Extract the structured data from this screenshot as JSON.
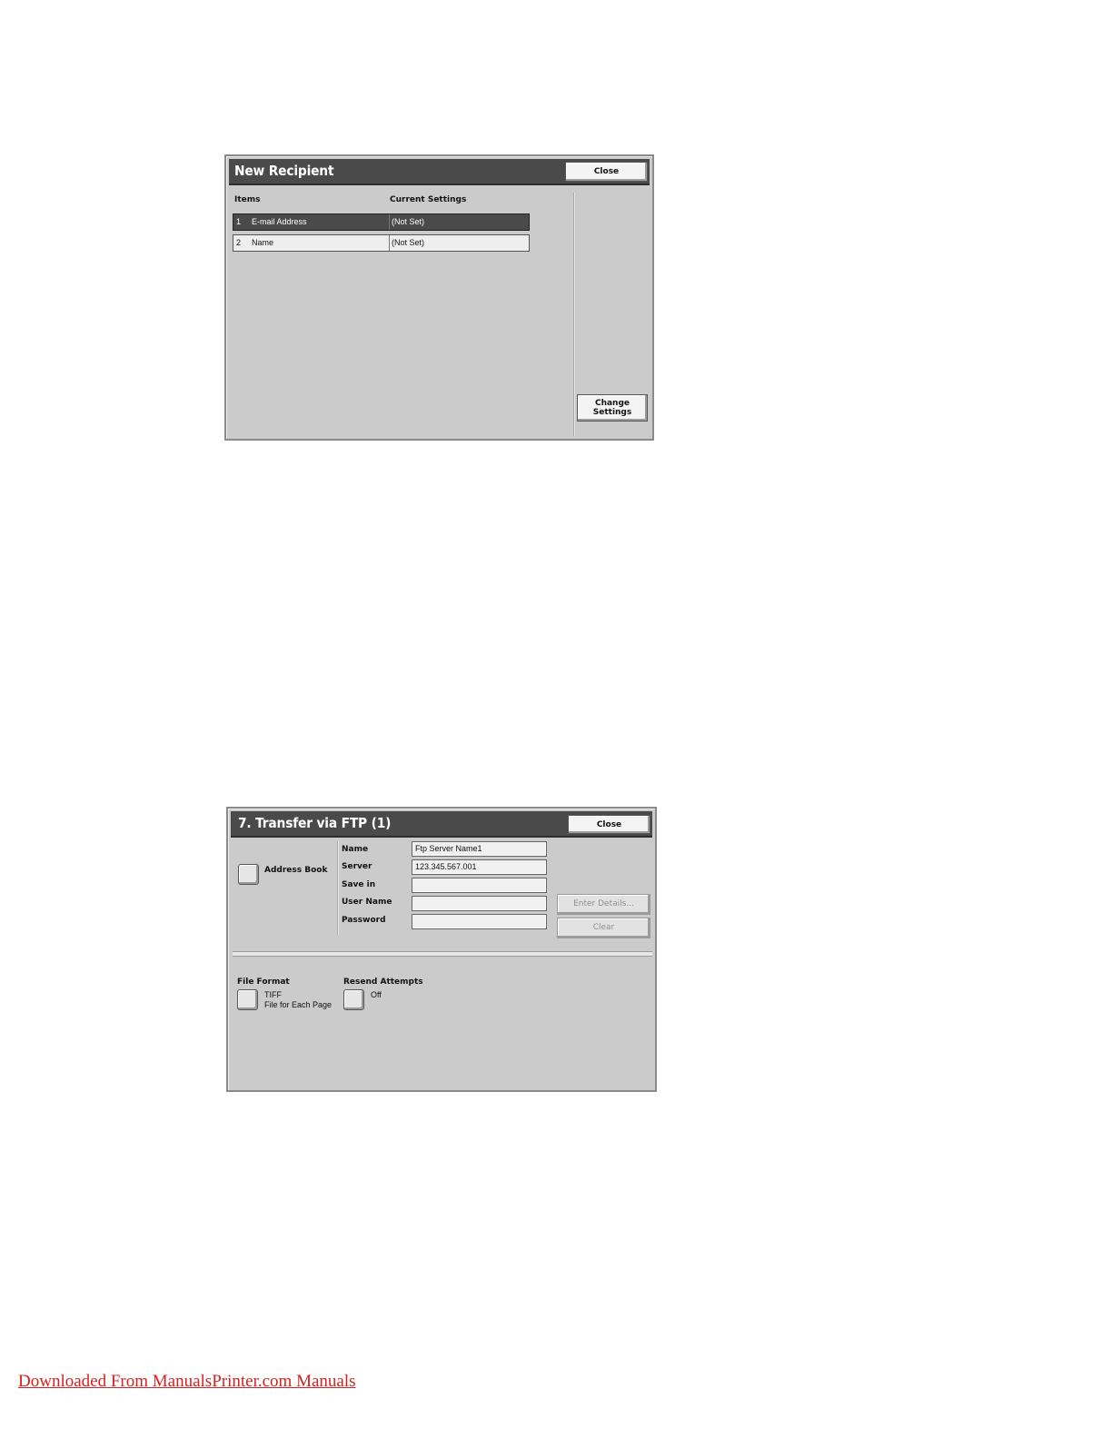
{
  "new_recipient": {
    "title": "New Recipient",
    "close_label": "Close",
    "col_items": "Items",
    "col_current": "Current Settings",
    "rows": [
      {
        "num": "1",
        "item": "E-mail Address",
        "value": "(Not Set)"
      },
      {
        "num": "2",
        "item": "Name",
        "value": "(Not Set)"
      }
    ],
    "change_settings_label": "Change Settings"
  },
  "ftp": {
    "title": "7. Transfer via FTP (1)",
    "close_label": "Close",
    "address_book_label": "Address Book",
    "fields": [
      {
        "label": "Name",
        "value": "Ftp Server Name1"
      },
      {
        "label": "Server",
        "value": "123.345.567.001"
      },
      {
        "label": "Save in",
        "value": ""
      },
      {
        "label": "User Name",
        "value": ""
      },
      {
        "label": "Password",
        "value": ""
      }
    ],
    "enter_details_label": "Enter Details...",
    "clear_label": "Clear",
    "file_format_label": "File Format",
    "file_format_value_1": "TIFF",
    "file_format_value_2": "File for Each Page",
    "resend_label": "Resend Attempts",
    "resend_value": "Off"
  },
  "footer": {
    "link_text": "Downloaded From ManualsPrinter.com Manuals"
  }
}
